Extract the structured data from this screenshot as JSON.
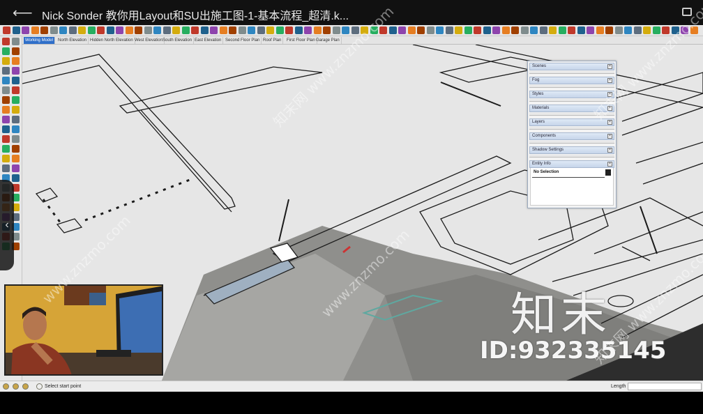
{
  "player": {
    "title": "Nick Sonder 教你用Layout和SU出施工图-1-基本流程_超清.k..."
  },
  "scenes": {
    "tabs": [
      {
        "label": "Working Model",
        "active": true
      },
      {
        "label": "North Elevation"
      },
      {
        "label": "Hidden North Elevation"
      },
      {
        "label": "West Elevation"
      },
      {
        "label": "South Elevation"
      },
      {
        "label": "East Elevation"
      },
      {
        "label": "Second Floor Plan"
      },
      {
        "label": "Roof Plan"
      },
      {
        "label": "First Floor Plan"
      },
      {
        "label": "Garage Plan"
      }
    ]
  },
  "tray": {
    "panels": [
      "Scenes",
      "Fog",
      "Styles",
      "Materials",
      "Layers",
      "Components",
      "Shadow Settings",
      "Entity Info"
    ],
    "entity_info": {
      "selection": "No Selection"
    }
  },
  "status": {
    "hint": "Select start point",
    "length_label": "Length"
  },
  "watermark": {
    "logo": "知末",
    "id": "ID:932335145",
    "diagonal": [
      "知末网 www.znzmo.com",
      "www.znzmo.com",
      "知末网 www.znzmo.com",
      "www.znzmo.com",
      "知末网 www.znzmo.com"
    ]
  },
  "colors": {
    "active_tab": "#2f6fc9",
    "tray_header": "#c6d5ea",
    "ground": "#e6e6e6",
    "shadow": "#8f8f8c"
  }
}
